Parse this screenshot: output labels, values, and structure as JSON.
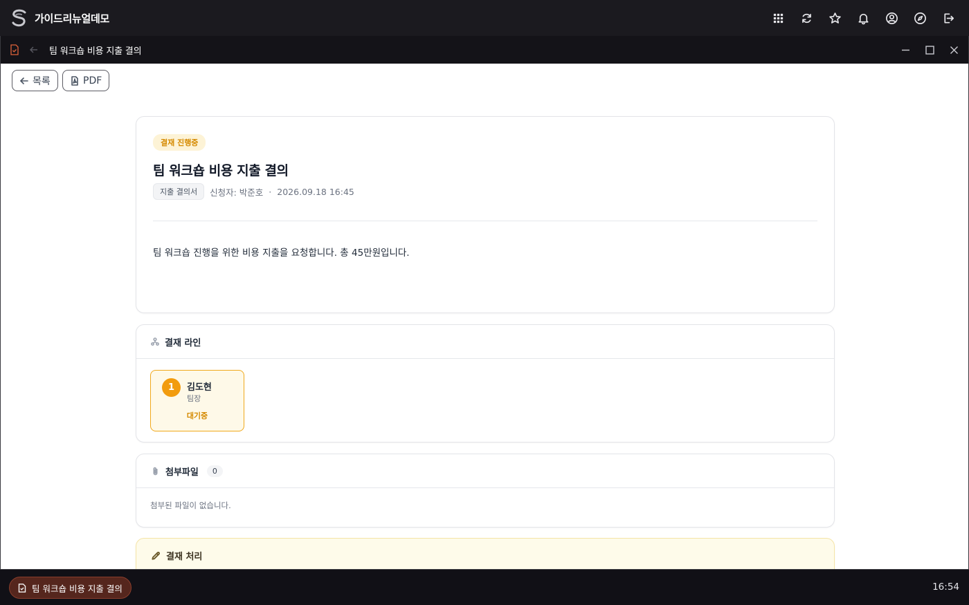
{
  "app": {
    "name": "가이드리뉴얼데모"
  },
  "topbar_icons": [
    "apps-grid-icon",
    "refresh-icon",
    "star-icon",
    "bell-icon",
    "user-circle-icon",
    "compass-icon",
    "logout-icon"
  ],
  "window": {
    "title": "팀 워크숍 비용 지출 결의"
  },
  "toolbar": {
    "back_label": "목록",
    "pdf_label": "PDF"
  },
  "document": {
    "status": "결재 진행중",
    "title": "팀 워크숍 비용 지출 결의",
    "type_tag": "지출 결의서",
    "requester": "신청자: 박준호",
    "separator": "·",
    "date": "2026.09.18 16:45",
    "body": "팀 워크숍 진행을 위한 비용 지출을 요청합니다. 총 45만원입니다."
  },
  "approval_line": {
    "title": "결재 라인",
    "approvers": [
      {
        "step": "1",
        "name": "김도현",
        "role": "팀장",
        "status": "대기중"
      }
    ]
  },
  "attachments": {
    "title": "첨부파일",
    "count": "0",
    "empty_text": "첨부된 파일이 없습니다."
  },
  "process": {
    "title": "결재 처리"
  },
  "taskbar": {
    "item_label": "팀 워크숍 비용 지출 결의",
    "clock": "16:54"
  },
  "colors": {
    "accent": "#f29c0e",
    "status_text": "#d58a00",
    "topbar": "#1b1a1f",
    "task_item": "#55261d"
  }
}
